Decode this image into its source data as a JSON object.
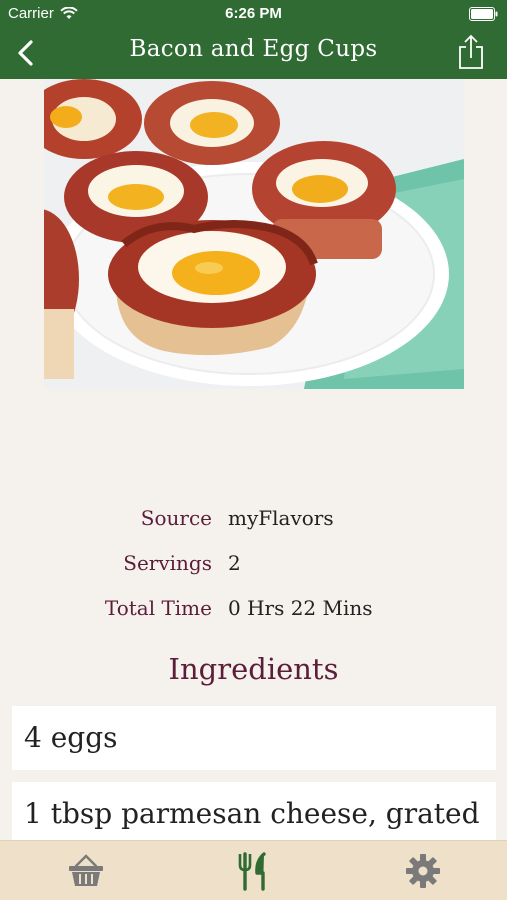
{
  "status_bar": {
    "carrier": "Carrier",
    "time": "6:26 PM"
  },
  "nav": {
    "title": "Bacon and Egg Cups"
  },
  "details": {
    "source_label": "Source",
    "source_value": "myFlavors",
    "servings_label": "Servings",
    "servings_value": "2",
    "total_time_label": "Total Time",
    "total_time_value": "0 Hrs 22 Mins"
  },
  "ingredients": {
    "heading": "Ingredients",
    "items": [
      "4 eggs",
      "1 tbsp parmesan cheese, grated"
    ]
  },
  "tabs": [
    {
      "icon": "basket-icon",
      "active": false
    },
    {
      "icon": "fork-knife-icon",
      "active": true
    },
    {
      "icon": "gear-icon",
      "active": false
    }
  ],
  "colors": {
    "header_green": "#2f6b33",
    "label_maroon": "#5c1d3b",
    "tab_bar_bg": "#efe0c9",
    "active_tab": "#2f6b33",
    "inactive_tab": "#7a7a7a"
  }
}
